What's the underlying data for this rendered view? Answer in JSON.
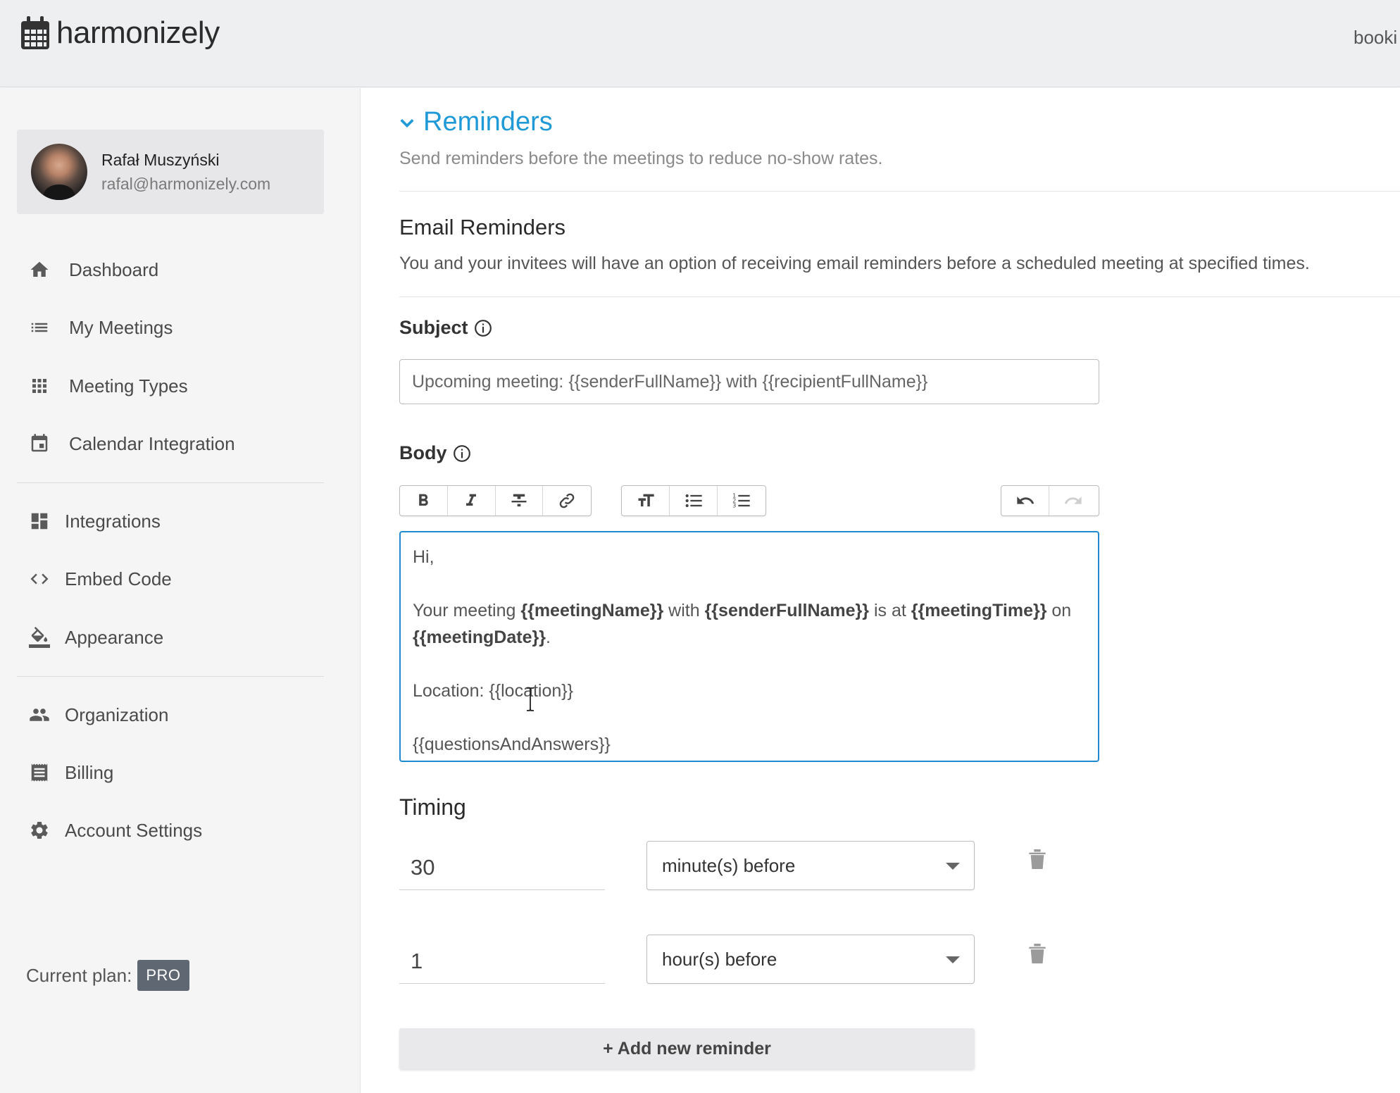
{
  "header": {
    "brand": "harmonizely",
    "top_link": "booki"
  },
  "profile": {
    "name": "Rafał Muszyński",
    "email": "rafal@harmonizely.com"
  },
  "nav": {
    "dashboard": "Dashboard",
    "my_meetings": "My Meetings",
    "meeting_types": "Meeting Types",
    "calendar_integration": "Calendar Integration",
    "integrations": "Integrations",
    "embed_code": "Embed Code",
    "appearance": "Appearance",
    "organization": "Organization",
    "billing": "Billing",
    "account_settings": "Account Settings"
  },
  "plan": {
    "label": "Current plan:",
    "badge": "PRO"
  },
  "section": {
    "title": "Reminders",
    "description": "Send reminders before the meetings to reduce no-show rates."
  },
  "email_reminders": {
    "title": "Email Reminders",
    "description": "You and your invitees will have an option of receiving email reminders before a scheduled meeting at specified times."
  },
  "subject": {
    "label": "Subject",
    "value": "Upcoming meeting: {{senderFullName}} with {{recipientFullName}}"
  },
  "body": {
    "label": "Body",
    "greeting": "Hi,",
    "line2_part1": "Your meeting ",
    "var_meeting_name": "{{meetingName}}",
    "line2_part2": " with ",
    "var_sender": "{{senderFullName}}",
    "line2_part3": " is at ",
    "var_meeting_time": "{{meetingTime}}",
    "line2_part4": " on",
    "var_meeting_date": "{{meetingDate}}",
    "line3_end": ".",
    "location_line": "Location: {{location}}",
    "qa_line": "{{questionsAndAnswers}}"
  },
  "toolbar": {
    "bold_icon": "bold-icon",
    "italic_icon": "italic-icon",
    "strikethrough_icon": "strikethrough-icon",
    "link_icon": "link-icon",
    "text_size_icon": "text-size-icon",
    "bullet_list_icon": "bullet-list-icon",
    "numbered_list_icon": "numbered-list-icon",
    "undo_icon": "undo-icon",
    "redo_icon": "redo-icon"
  },
  "timing": {
    "title": "Timing",
    "reminders": [
      {
        "amount": "30",
        "unit": "minute(s) before"
      },
      {
        "amount": "1",
        "unit": "hour(s) before"
      }
    ]
  },
  "add_reminder": "+ Add new reminder",
  "colors": {
    "accent": "#1f9ad6",
    "editor_focus": "#1f8ad0",
    "badge": "#5f6872"
  }
}
